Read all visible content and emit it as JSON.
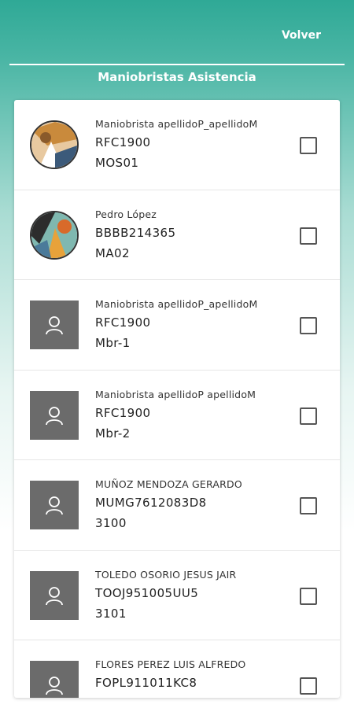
{
  "header": {
    "back_label": "Volver"
  },
  "page": {
    "title": "Maniobristas Asistencia"
  },
  "list": {
    "items": [
      {
        "name": "Maniobrista apellidoP_apellidoM",
        "rfc": "RFC1900",
        "code": "MOS01",
        "avatar": "photo-1",
        "checked": false
      },
      {
        "name": "Pedro López",
        "rfc": "BBBB214365",
        "code": "MA02",
        "avatar": "photo-2",
        "checked": false
      },
      {
        "name": "Maniobrista apellidoP_apellidoM",
        "rfc": "RFC1900",
        "code": "Mbr-1",
        "avatar": "user-placeholder",
        "checked": false
      },
      {
        "name": "Maniobrista apellidoP apellidoM",
        "rfc": "RFC1900",
        "code": "Mbr-2",
        "avatar": "user-placeholder",
        "checked": false
      },
      {
        "name": "MUÑOZ MENDOZA GERARDO",
        "rfc": "MUMG7612083D8",
        "code": "3100",
        "avatar": "user-placeholder",
        "checked": false
      },
      {
        "name": "TOLEDO OSORIO JESUS JAIR",
        "rfc": "TOOJ951005UU5",
        "code": "3101",
        "avatar": "user-placeholder",
        "checked": false
      },
      {
        "name": "FLORES PEREZ LUIS ALFREDO",
        "rfc": "FOPL911011KC8",
        "code": "",
        "avatar": "user-placeholder",
        "checked": false
      }
    ]
  }
}
